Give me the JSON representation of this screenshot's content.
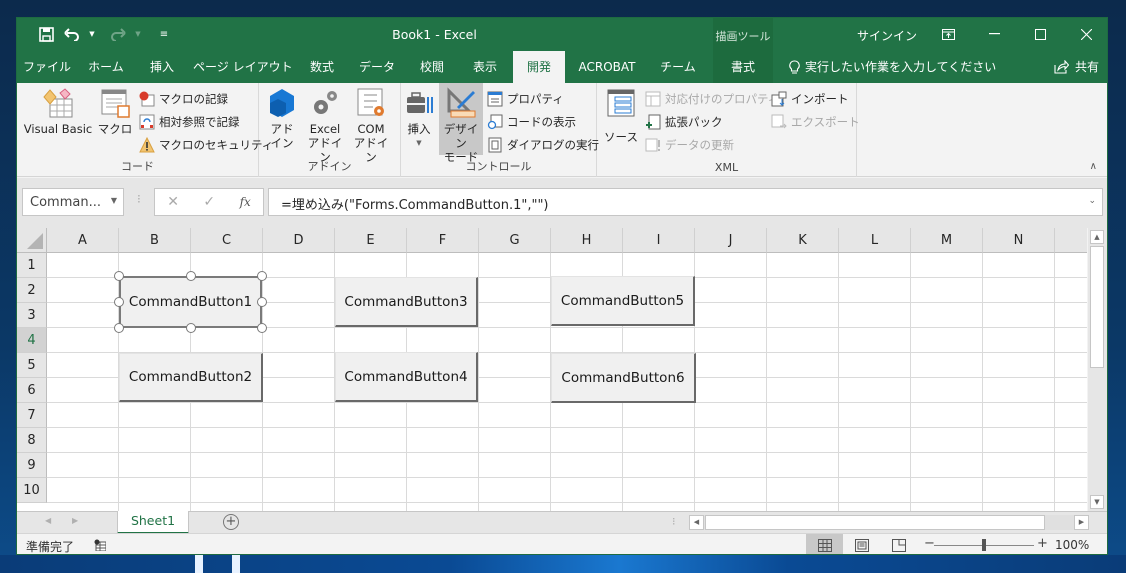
{
  "window": {
    "title": "Book1  -  Excel",
    "context_tools_label": "描画ツール",
    "signin_label": "サインイン",
    "controls": {
      "ribbon_display": "ribbon-display-options-icon",
      "minimize": "—",
      "maximize": "☐",
      "close": "✕"
    }
  },
  "qat": {
    "save": "save-icon",
    "undo": "undo-icon",
    "redo": "redo-icon",
    "customize": "customize-qat-icon"
  },
  "tabs": [
    {
      "label": "ファイル"
    },
    {
      "label": "ホーム"
    },
    {
      "label": "挿入"
    },
    {
      "label": "ページ レイアウト"
    },
    {
      "label": "数式"
    },
    {
      "label": "データ"
    },
    {
      "label": "校閲"
    },
    {
      "label": "表示"
    },
    {
      "label": "開発",
      "active": true
    },
    {
      "label": "ACROBAT"
    },
    {
      "label": "チーム"
    },
    {
      "label": "書式",
      "contextual": true
    }
  ],
  "tell_me": {
    "placeholder": "実行したい作業を入力してください"
  },
  "share_label": "共有",
  "ribbon": {
    "code": {
      "label": "コード",
      "visual_basic": "Visual Basic",
      "macros": "マクロ",
      "record_macro": "マクロの記録",
      "relative_refs": "相対参照で記録",
      "macro_security": "マクロのセキュリティ"
    },
    "addins": {
      "label": "アドイン",
      "addins_line1": "アド",
      "addins_line2": "イン",
      "excel_addins_line1": "Excel",
      "excel_addins_line2": "アドイン",
      "com_addins_line1": "COM",
      "com_addins_line2": "アドイン"
    },
    "controls": {
      "label": "コントロール",
      "insert": "挿入",
      "design_mode_line1": "デザイン",
      "design_mode_line2": "モード",
      "design_mode_pressed": true,
      "properties": "プロパティ",
      "view_code": "コードの表示",
      "run_dialog": "ダイアログの実行"
    },
    "xml": {
      "label": "XML",
      "source": "ソース",
      "map_properties": "対応付けのプロパティ",
      "expansion_packs": "拡張パック",
      "refresh_data": "データの更新",
      "import": "インポート",
      "export": "エクスポート"
    }
  },
  "formula_bar": {
    "name_box": "Comman...",
    "cancel": "✕",
    "enter": "✓",
    "fx": "fx",
    "formula": "=埋め込み(\"Forms.CommandButton.1\",\"\")"
  },
  "grid": {
    "columns": [
      "A",
      "B",
      "C",
      "D",
      "E",
      "F",
      "G",
      "H",
      "I",
      "J",
      "K",
      "L",
      "M",
      "N"
    ],
    "rows": [
      "1",
      "2",
      "3",
      "4",
      "5",
      "6",
      "7",
      "8",
      "9",
      "10"
    ],
    "selected_row": "4",
    "buttons": [
      {
        "label": "CommandButton1",
        "selected": true
      },
      {
        "label": "CommandButton2"
      },
      {
        "label": "CommandButton3"
      },
      {
        "label": "CommandButton4"
      },
      {
        "label": "CommandButton5"
      },
      {
        "label": "CommandButton6"
      }
    ]
  },
  "sheets": [
    {
      "label": "Sheet1",
      "active": true
    }
  ],
  "status": {
    "ready": "準備完了",
    "zoom_minus": "−",
    "zoom_plus": "+",
    "zoom_level": "100%",
    "zoom_percent": 100
  }
}
